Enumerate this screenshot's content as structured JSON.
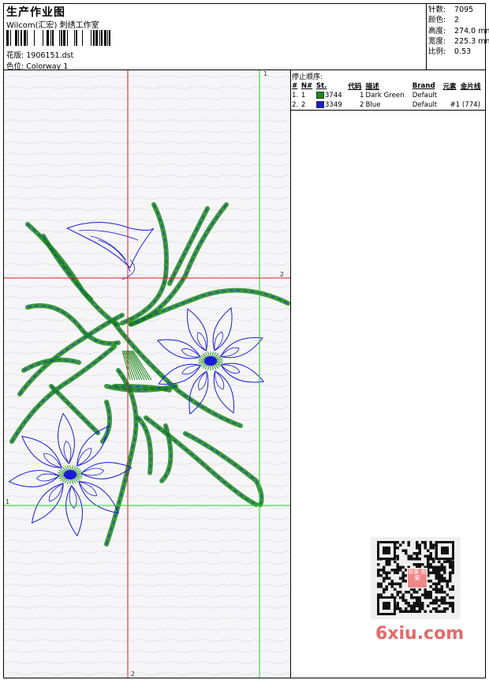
{
  "header": {
    "title": "生产作业图",
    "company": "Wilcom(汇宏) 刺绣工作室",
    "pattern_label": "花版:",
    "pattern_value": "1906151.dst",
    "colorway_label": "色位:",
    "colorway_value": "Colorway 1"
  },
  "stats": {
    "stitches_label": "针数:",
    "stitches_value": "7095",
    "colors_label": "颜色:",
    "colors_value": "2",
    "height_label": "高度:",
    "height_value": "274.0 mm",
    "width_label": "宽度:",
    "width_value": "225.3 mm",
    "scale_label": "比例:",
    "scale_value": "0.53"
  },
  "guides": {
    "label_1": "1",
    "label_2": "2"
  },
  "panel": {
    "title": "停止顺序:",
    "columns": [
      "#",
      "N#",
      "St.",
      "代码",
      "描述",
      "Brand",
      "元素",
      "金片线"
    ],
    "rows": [
      {
        "index": "1.",
        "n": "1",
        "color": "#1a8a1a",
        "code": "3744",
        "st": "1",
        "desc": "Dark Green",
        "brand": "Default",
        "element": ""
      },
      {
        "index": "2.",
        "n": "2",
        "color": "#1a1adb",
        "code": "3349",
        "st": "2",
        "desc": "Blue",
        "brand": "Default",
        "element": "#1 (774)"
      }
    ]
  },
  "watermark": {
    "text": "6xiu.com",
    "badge": "效果 图案"
  },
  "colors": {
    "green": "#1a8a1a",
    "blue": "#1a1adb",
    "guide_red": "#e01818",
    "guide_green": "#22cc22"
  }
}
